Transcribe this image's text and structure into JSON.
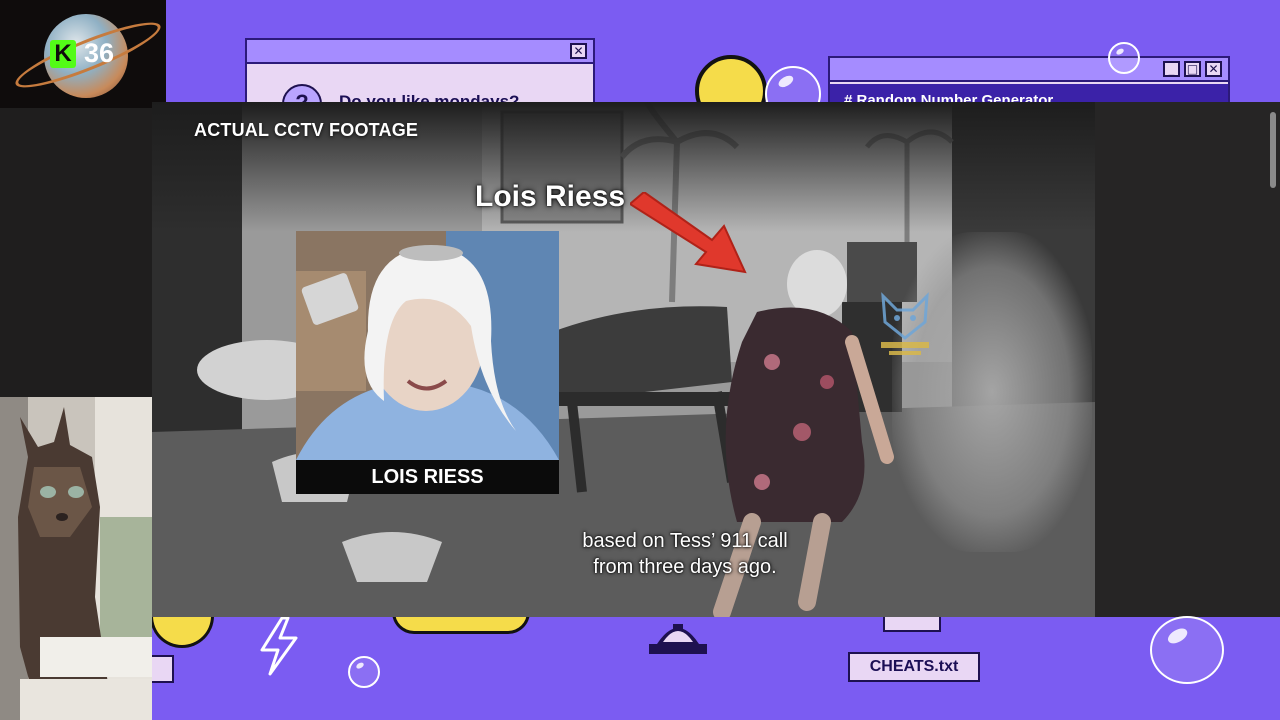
{
  "stream": {
    "kick_count": "36"
  },
  "desktop": {
    "monday_window": {
      "text": "Do you like mondays?",
      "close_glyph": "✕"
    },
    "rng_window": {
      "title": "# Random Number Generator",
      "min_glyph": "_",
      "max_glyph": "□",
      "close_glyph": "✕"
    },
    "file_icon_label": "CHEATS.txt",
    "colors": {
      "background": "#7b5cf2",
      "window": "#e9d7f4",
      "accent": "#a58cff"
    }
  },
  "video": {
    "top_left_label": "ACTUAL CCTV FOOTAGE",
    "name_callout": "Lois Riess",
    "portrait_caption": "LOIS RIESS",
    "subtitles": [
      "based on Tess’ 911 call",
      "from three days ago."
    ],
    "watermark_text": "EXPLORE WITH US"
  }
}
